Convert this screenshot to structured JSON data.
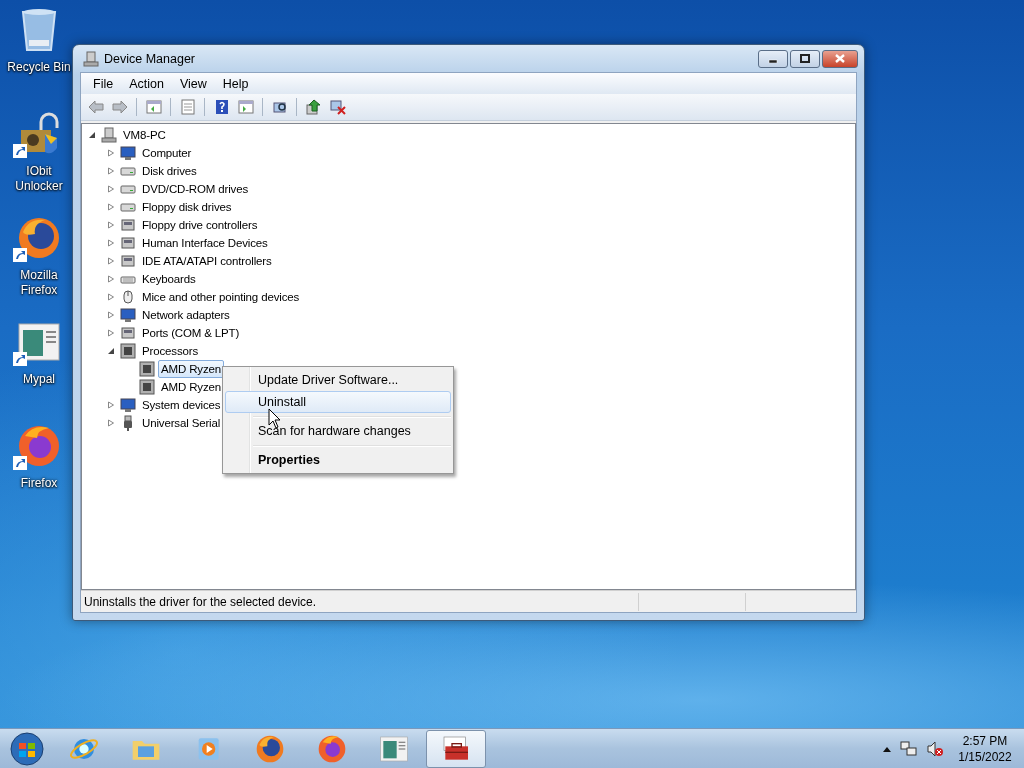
{
  "desktop_icons": [
    {
      "label": "Recycle Bin",
      "kind": "bin",
      "shortcut": false
    },
    {
      "label": "IObit Unlocker",
      "kind": "lock",
      "shortcut": true
    },
    {
      "label": "Mozilla Firefox",
      "kind": "firefox",
      "shortcut": true
    },
    {
      "label": "Mypal",
      "kind": "app",
      "shortcut": true
    },
    {
      "label": "Firefox",
      "kind": "firefox2",
      "shortcut": true
    }
  ],
  "window": {
    "title": "Device Manager",
    "menu": [
      "File",
      "Action",
      "View",
      "Help"
    ],
    "tree": [
      {
        "label": "VM8-PC",
        "kind": "pc",
        "expanded": true,
        "selected": false,
        "children": [
          {
            "label": "Computer",
            "kind": "monitor",
            "expanded": false,
            "selected": false
          },
          {
            "label": "Disk drives",
            "kind": "drive",
            "expanded": false,
            "selected": false
          },
          {
            "label": "DVD/CD-ROM drives",
            "kind": "drive",
            "expanded": false,
            "selected": false
          },
          {
            "label": "Floppy disk drives",
            "kind": "drive",
            "expanded": false,
            "selected": false
          },
          {
            "label": "Floppy drive controllers",
            "kind": "device",
            "expanded": false,
            "selected": false
          },
          {
            "label": "Human Interface Devices",
            "kind": "device",
            "expanded": false,
            "selected": false
          },
          {
            "label": "IDE ATA/ATAPI controllers",
            "kind": "device",
            "expanded": false,
            "selected": false
          },
          {
            "label": "Keyboards",
            "kind": "keyboard",
            "expanded": false,
            "selected": false
          },
          {
            "label": "Mice and other pointing devices",
            "kind": "mouse",
            "expanded": false,
            "selected": false
          },
          {
            "label": "Network adapters",
            "kind": "monitor",
            "expanded": false,
            "selected": false
          },
          {
            "label": "Ports (COM & LPT)",
            "kind": "device",
            "expanded": false,
            "selected": false
          },
          {
            "label": "Processors",
            "kind": "chip",
            "expanded": true,
            "selected": false,
            "children": [
              {
                "label": "AMD Ryzen",
                "kind": "chip",
                "selected": true
              },
              {
                "label": "AMD Ryzen",
                "kind": "chip",
                "selected": false
              }
            ]
          },
          {
            "label": "System devices",
            "kind": "monitor",
            "expanded": false,
            "selected": false
          },
          {
            "label": "Universal Serial",
            "kind": "plug",
            "expanded": false,
            "selected": false
          }
        ]
      }
    ],
    "status_bar": "Uninstalls the driver for the selected device."
  },
  "context_menu": [
    {
      "kind": "item",
      "label": "Update Driver Software...",
      "selected": false,
      "default": false
    },
    {
      "kind": "item",
      "label": "Uninstall",
      "selected": true,
      "default": false
    },
    {
      "kind": "separator"
    },
    {
      "kind": "item",
      "label": "Scan for hardware changes",
      "selected": false,
      "default": false
    },
    {
      "kind": "separator"
    },
    {
      "kind": "item",
      "label": "Properties",
      "selected": false,
      "default": true
    }
  ],
  "taskbar": {
    "items": [
      {
        "kind": "ie",
        "selected": false
      },
      {
        "kind": "folder",
        "selected": false
      },
      {
        "kind": "media",
        "selected": false
      },
      {
        "kind": "firefox",
        "selected": false
      },
      {
        "kind": "firefox2",
        "selected": false
      },
      {
        "kind": "app",
        "selected": false
      },
      {
        "kind": "toolbox",
        "selected": true
      }
    ],
    "time": "2:57 PM",
    "date": "1/15/2022"
  }
}
